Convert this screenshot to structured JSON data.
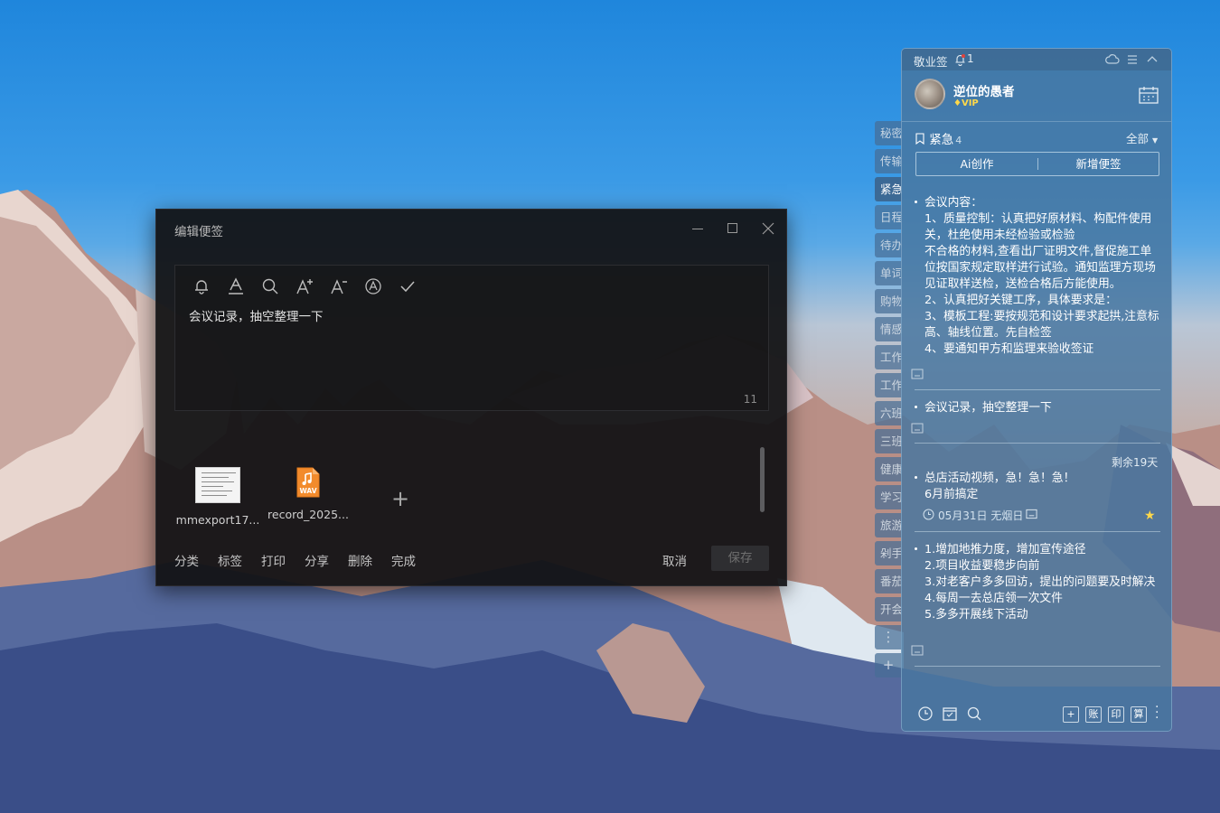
{
  "editor": {
    "title": "编辑便签",
    "note_text": "会议记录，抽空整理一下",
    "char_count": "11",
    "attachments": [
      {
        "name": "mmexport17...",
        "type": "image"
      },
      {
        "name": "record_2025...",
        "type": "audio",
        "badge": "WAV"
      }
    ],
    "actions": [
      "分类",
      "标签",
      "打印",
      "分享",
      "删除",
      "完成"
    ],
    "cancel_label": "取消",
    "save_label": "保存",
    "toolbar_icons": [
      "bell-icon",
      "font-color-icon",
      "search-icon",
      "font-increase-icon",
      "font-decrease-icon",
      "auto-format-icon",
      "check-icon"
    ]
  },
  "categories": [
    "秘密",
    "传输",
    "紧急",
    "日程",
    "待办",
    "单词",
    "购物",
    "情感",
    "工作",
    "工作",
    "六班",
    "三班",
    "健康",
    "学习",
    "旅游",
    "剁手",
    "番茄",
    "开会"
  ],
  "active_category": "紧急",
  "panel": {
    "app_name": "敬业签",
    "notification_count": "1",
    "username": "逆位的愚者",
    "vip_label": "VIP",
    "category_title": "紧急",
    "category_count": "4",
    "filter_label": "全部",
    "ai_button": "Ai创作",
    "new_button": "新增便签",
    "remaining": "剩余19天",
    "notes": [
      {
        "text": "会议内容：\n1、质量控制：认真把好原材料、构配件使用关，杜绝使用未经检验或检验\n不合格的材料,查看出厂证明文件,督促施工单位按国家规定取样进行试验。通知监理方现场见证取样送检，送检合格后方能使用。\n2、认真把好关键工序，具体要求是：\n3、模板工程:要按规范和设计要求起拱,注意标高、轴线位置。先自检签\n4、要通知甲方和监理来验收签证"
      },
      {
        "text": "会议记录，抽空整理一下"
      },
      {
        "text": "总店活动视频，急！急！急！\n6月前搞定",
        "date": "05月31日 无烟日"
      },
      {
        "text": "1.增加地推力度，增加宣传途径\n2.项目收益要稳步向前\n3.对老客户多多回访，提出的问题要及时解决\n4.每周一去总店领一次文件\n5.多多开展线下活动"
      }
    ],
    "bottom_boxes": [
      "+",
      "账",
      "印",
      "算"
    ]
  }
}
